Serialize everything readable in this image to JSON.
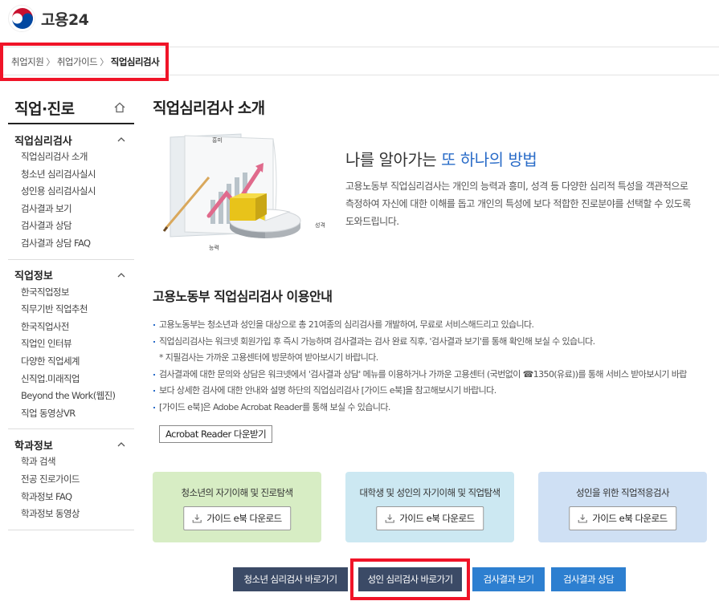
{
  "header": {
    "brand": "고용24"
  },
  "breadcrumb": {
    "items": [
      "취업지원",
      "취업가이드"
    ],
    "current": "직업심리검사",
    "sep": "〉"
  },
  "sidebar": {
    "title": "직업·진로",
    "groups": [
      {
        "title": "직업심리검사",
        "items": [
          "직업심리검사 소개",
          "청소년 심리검사실시",
          "성인용 심리검사실시",
          "검사결과 보기",
          "검사결과 상담",
          "검사결과 상담 FAQ"
        ]
      },
      {
        "title": "직업정보",
        "items": [
          "한국직업정보",
          "직무기반 직업추천",
          "한국직업사전",
          "직업인 인터뷰",
          "다양한 직업세계",
          "신직업.미래직업",
          "Beyond the Work(웹진)",
          "직업 동영상VR"
        ]
      },
      {
        "title": "학과정보",
        "items": [
          "학과 검색",
          "전공 진로가이드",
          "학과정보 FAQ",
          "학과정보 동영상"
        ]
      }
    ]
  },
  "main": {
    "title": "직업심리검사 소개",
    "hero": {
      "sub_prefix": "나를 알아가는 ",
      "sub_highlight": "또 하나의 방법",
      "desc": "고용노동부 직업심리검사는 개인의 능력과 흥미, 성격 등 다양한 심리적 특성을 객관적으로 측정하여 자신에 대한 이해를 돕고 개인의 특성에 보다 적합한 진로분야를 선택할 수 있도록 도와드립니다.",
      "illust_labels": {
        "interest": "흥미",
        "personality": "성격",
        "ability": "능력"
      }
    },
    "guide": {
      "title": "고용노동부 직업심리검사 이용안내",
      "items": [
        "고용노동부는 청소년과 성인을 대상으로 총 21여종의 심리검사를 개발하여, 무료로 서비스해드리고 있습니다.",
        "직업심리검사는 워크넷 회원가입 후 즉시 가능하며 검사결과는 검사 완료 직후, '검사결과 보기'를 통해 확인해 보실 수 있습니다.",
        "* 지필검사는 가까운 고용센터에 방문하여 받아보시기 바랍니다.",
        "검사결과에 대한 문의와 상담은 워크넷에서 '검사결과 상담' 메뉴를 이용하거나 가까운 고용센터 (국번없이 ☎1350(유료))를 통해 서비스 받아보시기 바랍",
        "보다 상세한 검사에 대한 안내와 설명 하단의 직업심리검사 [가이드 e북]을 참고해보시기 바랍니다.",
        "[가이드 e북]은 Adobe Acrobat Reader를 통해 보실 수 있습니다."
      ],
      "acrobat_button": "Acrobat Reader 다운받기"
    },
    "cards": [
      {
        "title": "청소년의 자기이해 및 진로탐색",
        "button": "가이드 e북 다운로드",
        "color": "#d7edc4"
      },
      {
        "title": "대학생 및 성인의 자기이해 및 직업탐색",
        "button": "가이드 e북 다운로드",
        "color": "#cce8f2"
      },
      {
        "title": "성인을 위한 직업적응검사",
        "button": "가이드 e북 다운로드",
        "color": "#cfe0f4"
      }
    ],
    "bottom_buttons": [
      "청소년 심리검사 바로가기",
      "성인 심리검사 바로가기",
      "검사결과 보기",
      "검사결과 상담"
    ]
  },
  "colors": {
    "highlight_box": "#f01428",
    "accent_blue": "#2a6cc8",
    "dark_button": "#3b4a66",
    "blue_button": "#2d7fd0"
  }
}
